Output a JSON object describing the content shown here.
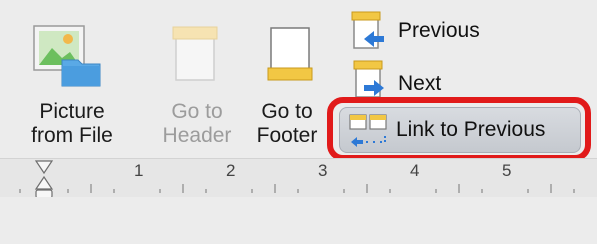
{
  "ribbon": {
    "picture_from_file": {
      "line1": "Picture",
      "line2": "from File",
      "icon": "picture-icon"
    },
    "go_to_header": {
      "line1": "Go to",
      "line2": "Header",
      "icon": "header-page-icon",
      "enabled": false
    },
    "go_to_footer": {
      "line1": "Go to",
      "line2": "Footer",
      "icon": "footer-page-icon",
      "enabled": true
    },
    "previous": {
      "label": "Previous",
      "icon": "previous-section-icon"
    },
    "next": {
      "label": "Next",
      "icon": "next-section-icon"
    },
    "link_to_previous": {
      "label": "Link to Previous",
      "icon": "link-to-previous-icon",
      "highlighted": true
    }
  },
  "ruler": {
    "numbers": [
      "1",
      "2",
      "3",
      "4",
      "5"
    ]
  },
  "colors": {
    "highlight_border": "#e11a1a",
    "arrow_blue": "#2d79d6",
    "page_accent_yellow": "#f2c744"
  }
}
